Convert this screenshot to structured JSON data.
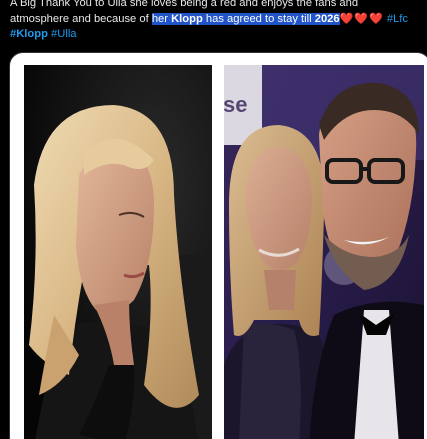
{
  "tweet": {
    "line1": "A Big Thank You to Ulla she loves being a red and enjoys the fans and",
    "line2_prefix": "atmosphere and because of ",
    "line2_highlight_a": "her ",
    "line2_highlight_bold": "Klopp",
    "line2_highlight_b": " has agreed to stay till ",
    "line2_highlight_year": "2026",
    "hearts": "❤️❤️❤️",
    "hashtag_lfc": "#Lfc",
    "hashtag_klopp": "#Klopp",
    "hashtag_ulla": "#Ulla"
  },
  "media": {
    "left_photo": {
      "icon": "photo-woman-blonde"
    },
    "right_photo": {
      "backdrop_text": "se",
      "icon": "photo-couple-event"
    }
  },
  "colors": {
    "text": "#e7e9ea",
    "hashtag": "#1d9bf0",
    "highlight": "#2663eb",
    "heart": "#e0245e",
    "background": "#000000"
  }
}
